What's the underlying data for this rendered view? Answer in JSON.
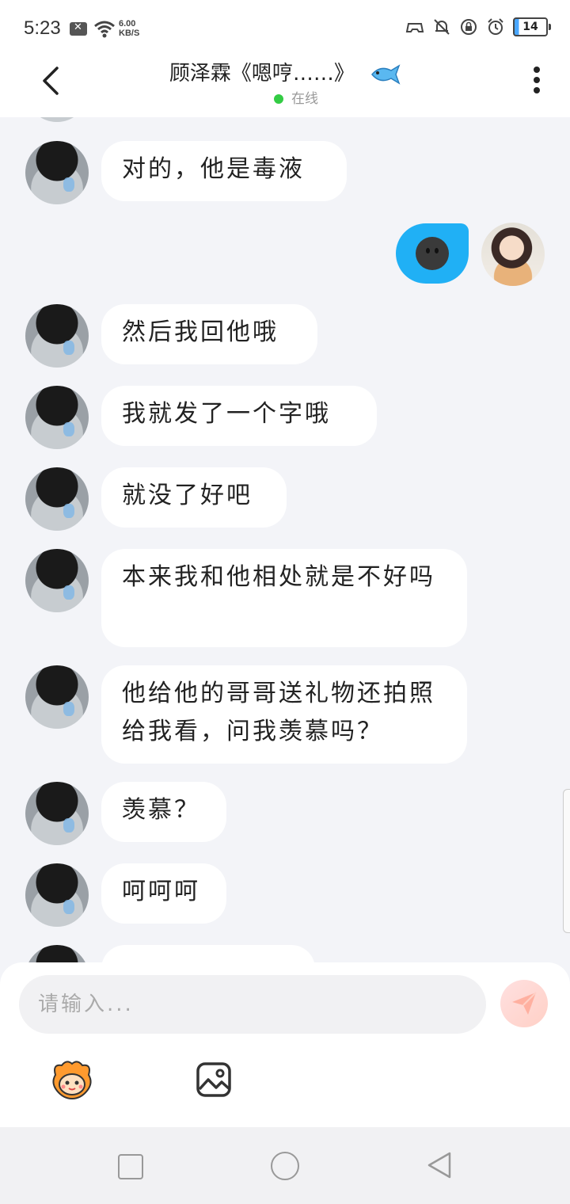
{
  "status_bar": {
    "time": "5:23",
    "net_speed_value": "6.00",
    "net_speed_unit": "KB/S",
    "battery": "14"
  },
  "header": {
    "title": "顾泽霖《嗯哼……》",
    "status": "在线"
  },
  "messages": [
    {
      "from": "other",
      "text": "对的，他是毒液"
    },
    {
      "from": "me",
      "type": "emoji",
      "icon": "black-smiley-emoji"
    },
    {
      "from": "other",
      "text": "然后我回他哦"
    },
    {
      "from": "other",
      "text": "我就发了一个字哦"
    },
    {
      "from": "other",
      "text": "就没了好吧"
    },
    {
      "from": "other",
      "text": "本来我和他相处就是不好吗"
    },
    {
      "from": "other",
      "text": "他给他的哥哥送礼物还拍照给我看，问我羡慕吗？"
    },
    {
      "from": "other",
      "text": "羡慕？"
    },
    {
      "from": "other",
      "text": "呵呵呵"
    }
  ],
  "input": {
    "placeholder": "请输入..."
  },
  "colors": {
    "accent_blue": "#20b0f5",
    "online_green": "#33cc44",
    "chat_background": "#f3f4f8"
  }
}
